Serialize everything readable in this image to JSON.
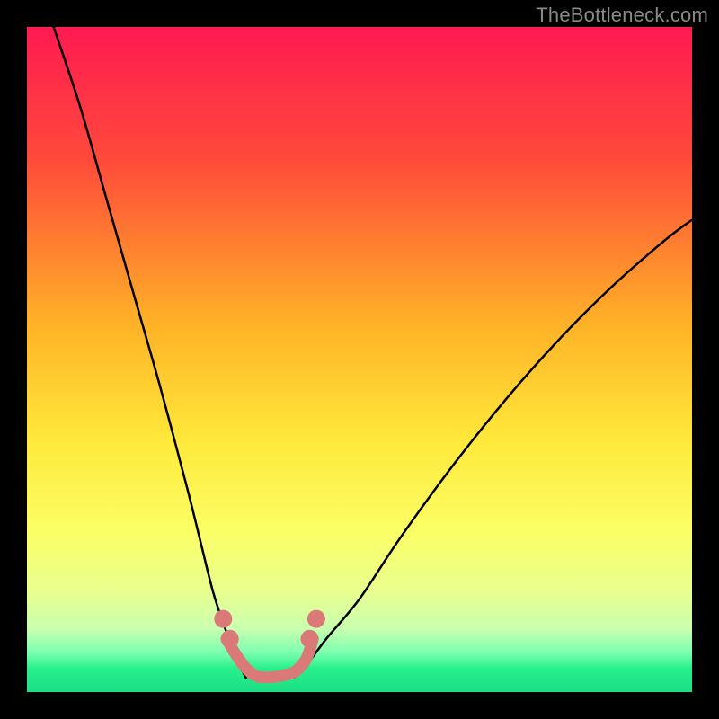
{
  "watermark": "TheBottleneck.com",
  "chart_data": {
    "type": "line",
    "title": "",
    "xlabel": "",
    "ylabel": "",
    "xlim": [
      0,
      100
    ],
    "ylim": [
      0,
      100
    ],
    "gradient_stops": [
      {
        "offset": 0,
        "color": "#ff1a52"
      },
      {
        "offset": 0.2,
        "color": "#ff4a3a"
      },
      {
        "offset": 0.45,
        "color": "#ffb327"
      },
      {
        "offset": 0.62,
        "color": "#ffe83a"
      },
      {
        "offset": 0.76,
        "color": "#fbff66"
      },
      {
        "offset": 0.85,
        "color": "#e8ff8f"
      },
      {
        "offset": 0.905,
        "color": "#c9ffb0"
      },
      {
        "offset": 0.94,
        "color": "#7dffb0"
      },
      {
        "offset": 0.965,
        "color": "#28ef8d"
      },
      {
        "offset": 1.0,
        "color": "#1adf84"
      }
    ],
    "series": [
      {
        "name": "left-curve",
        "x": [
          4,
          8,
          12,
          16,
          20,
          24,
          26,
          28,
          30,
          32,
          33
        ],
        "y": [
          100,
          88,
          74,
          60,
          46,
          31,
          23,
          15,
          9,
          4,
          2
        ]
      },
      {
        "name": "right-curve",
        "x": [
          40,
          42,
          45,
          50,
          56,
          64,
          72,
          80,
          88,
          96,
          100
        ],
        "y": [
          2,
          4,
          8,
          14,
          23,
          34,
          44,
          53,
          61,
          68,
          71
        ]
      },
      {
        "name": "bottom-segment",
        "x": [
          30,
          31.5,
          33,
          34.5,
          36,
          37.5,
          39,
          40.5,
          42,
          43
        ],
        "y": [
          8,
          5.5,
          3.5,
          2.4,
          2.2,
          2.3,
          2.6,
          3.2,
          5,
          8
        ]
      }
    ],
    "accent_color": "#d97a78",
    "curve_color": "#000000"
  }
}
